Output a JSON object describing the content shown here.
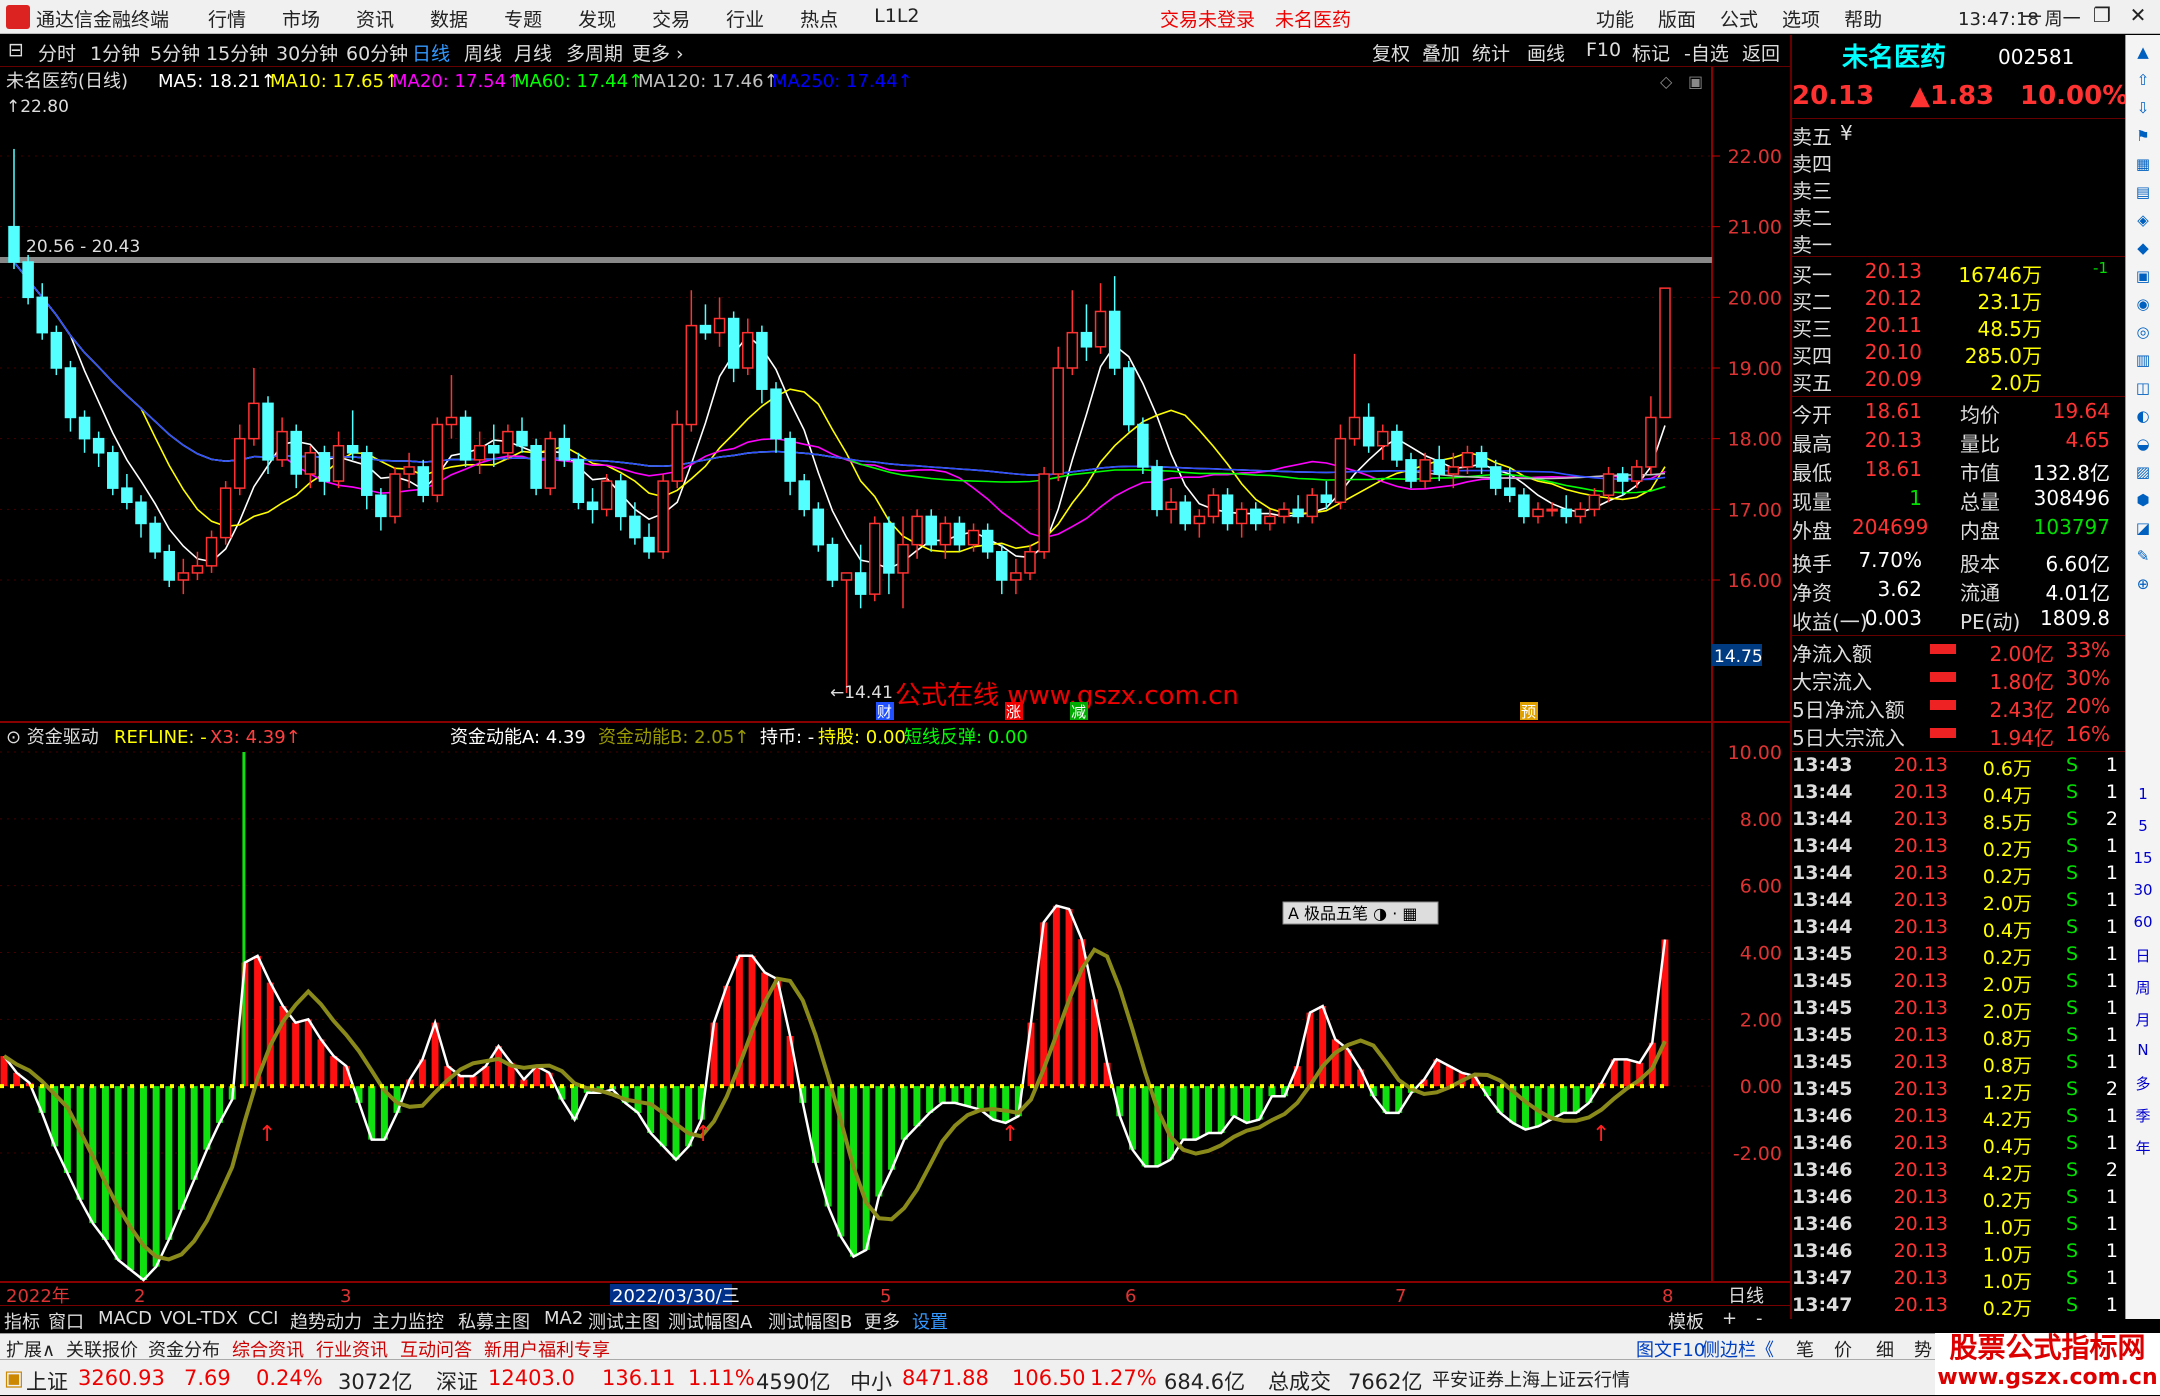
{
  "window": {
    "app_title": "通达信金融终端",
    "main_menu": [
      "行情",
      "市场",
      "资讯",
      "数据",
      "专题",
      "发现",
      "交易",
      "行业",
      "热点",
      "L1L2"
    ],
    "alerts": [
      "交易未登录",
      "未名医药"
    ],
    "right_menu": [
      "功能",
      "版面",
      "公式",
      "选项",
      "帮助"
    ],
    "clock": "13:47:18",
    "weekday": "周一"
  },
  "period_bar": {
    "tabs": [
      "分时",
      "1分钟",
      "5分钟",
      "15分钟",
      "30分钟",
      "60分钟",
      "日线",
      "周线",
      "月线",
      "多周期",
      "更多"
    ],
    "active": "日线",
    "tools": [
      "复权",
      "叠加",
      "统计",
      "画线",
      "F10",
      "标记",
      "-自选",
      "返回"
    ]
  },
  "main_chart": {
    "stock_name": "未名医药(日线)",
    "ma_labels": [
      {
        "text": "MA5: 18.21",
        "color": "#ffffff"
      },
      {
        "text": "MA10: 17.65",
        "color": "#ffff00"
      },
      {
        "text": "MA20: 17.54",
        "color": "#ff00ff"
      },
      {
        "text": "MA60: 17.44",
        "color": "#00ff00"
      },
      {
        "text": "MA120: 17.46",
        "color": "#c0c0c0"
      },
      {
        "text": "MA250: 17.44",
        "color": "#0000ff"
      }
    ],
    "high_label": "22.80",
    "range_label": "20.56 - 20.43",
    "low_label": "14.41",
    "y_ticks": [
      "22.00",
      "21.00",
      "20.00",
      "19.00",
      "18.00",
      "17.00",
      "16.00"
    ],
    "y_values": [
      22,
      21,
      20,
      19,
      18,
      17,
      16
    ],
    "price_box": "14.75",
    "watermark": "公式在线   www.gszx.com.cn",
    "markers": [
      "财",
      "涨",
      "减",
      "预"
    ]
  },
  "indicator": {
    "name": "资金驱动",
    "labels": [
      {
        "text": "REFLINE: -",
        "color": "#ffff00"
      },
      {
        "text": "X3: 4.39",
        "color": "#ff4040"
      },
      {
        "text": "资金动能A: 4.39",
        "color": "#ffffff"
      },
      {
        "text": "资金动能B: 2.05",
        "color": "#999900"
      },
      {
        "text": "持币: -",
        "color": "#ffffff"
      },
      {
        "text": "持股: 0.00",
        "color": "#ffff00"
      },
      {
        "text": "短线反弹: 0.00",
        "color": "#00ff00"
      }
    ],
    "y_ticks": [
      "10.00",
      "8.00",
      "6.00",
      "4.00",
      "2.00",
      "0.00",
      "-2.00"
    ],
    "y_values": [
      10,
      8,
      6,
      4,
      2,
      0,
      -2
    ],
    "pen_toolbar": "极品五笔"
  },
  "x_axis": {
    "labels": [
      "2022年",
      "2",
      "3",
      "2022/03/30/三",
      "5",
      "6",
      "7",
      "8"
    ],
    "period": "日线"
  },
  "quote": {
    "name": "未名医药",
    "code": "002581",
    "price": "20.13",
    "change": "▲1.83",
    "change_pct": "10.00%",
    "sell_rows": [
      "卖五",
      "卖四",
      "卖三",
      "卖二",
      "卖一"
    ],
    "currency_mark": "¥",
    "buy_rows": [
      {
        "label": "买一",
        "price": "20.13",
        "vol": "16746万",
        "delta": "-1"
      },
      {
        "label": "买二",
        "price": "20.12",
        "vol": "23.1万",
        "delta": ""
      },
      {
        "label": "买三",
        "price": "20.11",
        "vol": "48.5万",
        "delta": ""
      },
      {
        "label": "买四",
        "price": "20.10",
        "vol": "285.0万",
        "delta": ""
      },
      {
        "label": "买五",
        "price": "20.09",
        "vol": "2.0万",
        "delta": ""
      }
    ],
    "stats": [
      {
        "l1": "今开",
        "v1": "18.61",
        "c1": "red",
        "l2": "均价",
        "v2": "19.64",
        "c2": "red"
      },
      {
        "l1": "最高",
        "v1": "20.13",
        "c1": "red",
        "l2": "量比",
        "v2": "4.65",
        "c2": "red"
      },
      {
        "l1": "最低",
        "v1": "18.61",
        "c1": "red",
        "l2": "市值",
        "v2": "132.8亿",
        "c2": "white"
      },
      {
        "l1": "现量",
        "v1": "1",
        "c1": "green",
        "l2": "总量",
        "v2": "308496",
        "c2": "white"
      },
      {
        "l1": "外盘",
        "v1": "204699",
        "c1": "red",
        "l2": "内盘",
        "v2": "103797",
        "c2": "green"
      },
      {
        "l1": "换手",
        "v1": "7.70%",
        "c1": "white",
        "l2": "股本",
        "v2": "6.60亿",
        "c2": "white"
      },
      {
        "l1": "净资",
        "v1": "3.62",
        "c1": "white",
        "l2": "流通",
        "v2": "4.01亿",
        "c2": "white"
      },
      {
        "l1": "收益(一)",
        "v1": "0.003",
        "c1": "white",
        "l2": "PE(动)",
        "v2": "1809.8",
        "c2": "white"
      }
    ],
    "flows": [
      {
        "label": "净流入额",
        "val": "2.00亿",
        "pct": "33%"
      },
      {
        "label": "大宗流入",
        "val": "1.80亿",
        "pct": "30%"
      },
      {
        "label": "5日净流入额",
        "val": "2.43亿",
        "pct": "20%"
      },
      {
        "label": "5日大宗流入",
        "val": "1.94亿",
        "pct": "16%"
      }
    ],
    "ticks": [
      [
        "13:43",
        "20.13",
        "0.6万",
        "S",
        "1"
      ],
      [
        "13:44",
        "20.13",
        "0.4万",
        "S",
        "1"
      ],
      [
        "13:44",
        "20.13",
        "8.5万",
        "S",
        "2"
      ],
      [
        "13:44",
        "20.13",
        "0.2万",
        "S",
        "1"
      ],
      [
        "13:44",
        "20.13",
        "0.2万",
        "S",
        "1"
      ],
      [
        "13:44",
        "20.13",
        "2.0万",
        "S",
        "1"
      ],
      [
        "13:44",
        "20.13",
        "0.4万",
        "S",
        "1"
      ],
      [
        "13:45",
        "20.13",
        "0.2万",
        "S",
        "1"
      ],
      [
        "13:45",
        "20.13",
        "2.0万",
        "S",
        "1"
      ],
      [
        "13:45",
        "20.13",
        "2.0万",
        "S",
        "1"
      ],
      [
        "13:45",
        "20.13",
        "0.8万",
        "S",
        "1"
      ],
      [
        "13:45",
        "20.13",
        "0.8万",
        "S",
        "1"
      ],
      [
        "13:45",
        "20.13",
        "1.2万",
        "S",
        "2"
      ],
      [
        "13:46",
        "20.13",
        "4.2万",
        "S",
        "1"
      ],
      [
        "13:46",
        "20.13",
        "0.4万",
        "S",
        "1"
      ],
      [
        "13:46",
        "20.13",
        "4.2万",
        "S",
        "2"
      ],
      [
        "13:46",
        "20.13",
        "0.2万",
        "S",
        "1"
      ],
      [
        "13:46",
        "20.13",
        "1.0万",
        "S",
        "1"
      ],
      [
        "13:46",
        "20.13",
        "1.0万",
        "S",
        "1"
      ],
      [
        "13:47",
        "20.13",
        "1.0万",
        "S",
        "1"
      ],
      [
        "13:47",
        "20.13",
        "0.2万",
        "S",
        "1"
      ]
    ]
  },
  "sidebar_labels": [
    "1",
    "5",
    "15",
    "30",
    "60",
    "日",
    "周",
    "月",
    "N",
    "多",
    "季",
    "年"
  ],
  "indicator_tabs": [
    "指标",
    "窗口",
    "MACD",
    "VOL-TDX",
    "CCI",
    "趋势动力",
    "主力监控",
    "私募主图",
    "MA2",
    "测试主图",
    "测试幅图A",
    "测试幅图B",
    "更多",
    "设置",
    "模板",
    "+",
    "-"
  ],
  "func_tabs": [
    "扩展∧",
    "关联报价",
    "资金分布",
    "综合资讯",
    "行业资讯",
    "互动问答",
    "新用户福利专享",
    "图文F10",
    "侧边栏《",
    "笔",
    "价",
    "细",
    "势"
  ],
  "status": {
    "sh_label": "上证",
    "sh": "3260.93",
    "sh_ch": "7.69",
    "sh_pct": "0.24%",
    "sh_amt": "3072亿",
    "sz_label": "深证",
    "sz": "12403.0",
    "sz_ch": "136.11",
    "sz_pct": "1.11%",
    "sz_amt": "4590亿",
    "zx_label": "中小",
    "zx": "8471.88",
    "zx_ch": "106.50",
    "zx_pct": "1.27%",
    "zx_amt": "684.6亿",
    "total_label": "总成交",
    "total": "7662亿",
    "broker": "平安证券上海上证云行情"
  },
  "brand_watermark": [
    "股票公式指标网",
    "www.gszx.com.cn"
  ],
  "chart_data": {
    "type": "candlestick",
    "ma_periods": [
      5,
      10,
      20,
      60,
      120,
      250
    ],
    "ohlc": [
      [
        21.0,
        22.1,
        20.4,
        20.5
      ],
      [
        20.5,
        20.6,
        19.9,
        20.0
      ],
      [
        20.0,
        20.2,
        19.4,
        19.5
      ],
      [
        19.5,
        19.6,
        18.9,
        19.0
      ],
      [
        19.0,
        19.1,
        18.1,
        18.3
      ],
      [
        18.3,
        18.4,
        17.8,
        18.0
      ],
      [
        18.0,
        18.1,
        17.6,
        17.8
      ],
      [
        17.8,
        17.9,
        17.2,
        17.3
      ],
      [
        17.3,
        17.5,
        17.0,
        17.1
      ],
      [
        17.1,
        17.2,
        16.6,
        16.8
      ],
      [
        16.8,
        16.9,
        16.3,
        16.4
      ],
      [
        16.4,
        16.5,
        15.9,
        16.0
      ],
      [
        16.0,
        16.3,
        15.8,
        16.1
      ],
      [
        16.1,
        16.4,
        16.0,
        16.2
      ],
      [
        16.2,
        16.7,
        16.1,
        16.6
      ],
      [
        16.6,
        17.4,
        16.5,
        17.3
      ],
      [
        17.3,
        18.2,
        17.2,
        18.0
      ],
      [
        18.0,
        19.0,
        17.9,
        18.5
      ],
      [
        18.5,
        18.6,
        17.5,
        17.7
      ],
      [
        17.7,
        18.3,
        17.6,
        18.1
      ],
      [
        18.1,
        18.2,
        17.3,
        17.5
      ],
      [
        17.5,
        17.9,
        17.3,
        17.8
      ],
      [
        17.8,
        17.9,
        17.2,
        17.4
      ],
      [
        17.4,
        18.1,
        17.3,
        17.9
      ],
      [
        17.9,
        18.4,
        17.7,
        17.8
      ],
      [
        17.8,
        17.9,
        17.0,
        17.2
      ],
      [
        17.2,
        17.3,
        16.7,
        16.9
      ],
      [
        16.9,
        17.6,
        16.8,
        17.5
      ],
      [
        17.5,
        17.8,
        17.3,
        17.6
      ],
      [
        17.6,
        17.7,
        17.1,
        17.2
      ],
      [
        17.2,
        18.3,
        17.1,
        18.2
      ],
      [
        18.2,
        18.9,
        18.0,
        18.3
      ],
      [
        18.3,
        18.4,
        17.6,
        17.7
      ],
      [
        17.7,
        18.1,
        17.5,
        17.9
      ],
      [
        17.9,
        18.2,
        17.6,
        17.8
      ],
      [
        17.8,
        18.2,
        17.7,
        18.1
      ],
      [
        18.1,
        18.3,
        17.8,
        17.9
      ],
      [
        17.9,
        18.0,
        17.2,
        17.3
      ],
      [
        17.3,
        18.1,
        17.2,
        18.0
      ],
      [
        18.0,
        18.2,
        17.6,
        17.7
      ],
      [
        17.7,
        17.8,
        17.0,
        17.1
      ],
      [
        17.1,
        17.3,
        16.8,
        17.0
      ],
      [
        17.0,
        17.5,
        16.9,
        17.4
      ],
      [
        17.4,
        17.5,
        16.7,
        16.9
      ],
      [
        16.9,
        17.1,
        16.5,
        16.6
      ],
      [
        16.6,
        16.8,
        16.3,
        16.4
      ],
      [
        16.4,
        17.5,
        16.3,
        17.4
      ],
      [
        17.4,
        18.4,
        17.3,
        18.2
      ],
      [
        18.2,
        20.1,
        18.1,
        19.6
      ],
      [
        19.6,
        19.9,
        19.4,
        19.5
      ],
      [
        19.5,
        20.0,
        19.3,
        19.7
      ],
      [
        19.7,
        19.8,
        18.8,
        19.0
      ],
      [
        19.0,
        19.7,
        18.9,
        19.5
      ],
      [
        19.5,
        19.6,
        18.5,
        18.7
      ],
      [
        18.7,
        18.8,
        17.8,
        18.0
      ],
      [
        18.0,
        18.1,
        17.2,
        17.4
      ],
      [
        17.4,
        17.5,
        16.9,
        17.0
      ],
      [
        17.0,
        17.1,
        16.4,
        16.5
      ],
      [
        16.5,
        16.6,
        15.9,
        16.0
      ],
      [
        16.0,
        16.1,
        14.4,
        16.1
      ],
      [
        16.1,
        16.5,
        15.6,
        15.8
      ],
      [
        15.8,
        16.9,
        15.7,
        16.8
      ],
      [
        16.8,
        16.9,
        15.8,
        16.1
      ],
      [
        16.1,
        16.9,
        15.6,
        16.5
      ],
      [
        16.5,
        17.0,
        16.3,
        16.9
      ],
      [
        16.9,
        17.0,
        16.4,
        16.5
      ],
      [
        16.5,
        16.9,
        16.3,
        16.8
      ],
      [
        16.8,
        16.9,
        16.4,
        16.5
      ],
      [
        16.5,
        16.8,
        16.4,
        16.7
      ],
      [
        16.7,
        16.8,
        16.3,
        16.4
      ],
      [
        16.4,
        16.5,
        15.8,
        16.0
      ],
      [
        16.0,
        16.3,
        15.8,
        16.1
      ],
      [
        16.1,
        16.5,
        16.0,
        16.4
      ],
      [
        16.4,
        17.6,
        16.3,
        17.5
      ],
      [
        17.5,
        19.3,
        17.4,
        19.0
      ],
      [
        19.0,
        20.1,
        18.9,
        19.5
      ],
      [
        19.5,
        19.9,
        19.1,
        19.3
      ],
      [
        19.3,
        20.2,
        19.2,
        19.8
      ],
      [
        19.8,
        20.3,
        18.9,
        19.0
      ],
      [
        19.0,
        19.1,
        18.1,
        18.2
      ],
      [
        18.2,
        18.3,
        17.5,
        17.6
      ],
      [
        17.6,
        17.7,
        16.9,
        17.0
      ],
      [
        17.0,
        17.3,
        16.8,
        17.1
      ],
      [
        17.1,
        17.2,
        16.7,
        16.8
      ],
      [
        16.8,
        17.0,
        16.6,
        16.9
      ],
      [
        16.9,
        17.3,
        16.8,
        17.2
      ],
      [
        17.2,
        17.3,
        16.7,
        16.8
      ],
      [
        16.8,
        17.1,
        16.6,
        17.0
      ],
      [
        17.0,
        17.1,
        16.7,
        16.8
      ],
      [
        16.8,
        17.0,
        16.7,
        16.9
      ],
      [
        16.9,
        17.1,
        16.8,
        17.0
      ],
      [
        17.0,
        17.2,
        16.8,
        16.9
      ],
      [
        16.9,
        17.3,
        16.8,
        17.2
      ],
      [
        17.2,
        17.4,
        17.0,
        17.1
      ],
      [
        17.1,
        18.2,
        17.0,
        18.0
      ],
      [
        18.0,
        19.2,
        17.9,
        18.3
      ],
      [
        18.3,
        18.5,
        17.8,
        17.9
      ],
      [
        17.9,
        18.2,
        17.7,
        18.1
      ],
      [
        18.1,
        18.2,
        17.6,
        17.7
      ],
      [
        17.7,
        17.8,
        17.3,
        17.4
      ],
      [
        17.4,
        17.8,
        17.3,
        17.7
      ],
      [
        17.7,
        17.9,
        17.4,
        17.5
      ],
      [
        17.5,
        17.8,
        17.3,
        17.6
      ],
      [
        17.6,
        17.9,
        17.5,
        17.8
      ],
      [
        17.8,
        17.9,
        17.5,
        17.6
      ],
      [
        17.6,
        17.7,
        17.2,
        17.3
      ],
      [
        17.3,
        17.6,
        17.1,
        17.2
      ],
      [
        17.2,
        17.3,
        16.8,
        16.9
      ],
      [
        16.9,
        17.1,
        16.8,
        17.0
      ],
      [
        17.0,
        17.1,
        16.9,
        17.0
      ],
      [
        17.0,
        17.2,
        16.8,
        16.9
      ],
      [
        16.9,
        17.1,
        16.8,
        17.0
      ],
      [
        17.0,
        17.3,
        16.9,
        17.2
      ],
      [
        17.2,
        17.6,
        17.1,
        17.5
      ],
      [
        17.5,
        17.6,
        17.2,
        17.4
      ],
      [
        17.4,
        17.7,
        17.3,
        17.6
      ],
      [
        17.6,
        18.6,
        17.5,
        18.3
      ],
      [
        18.3,
        20.13,
        18.3,
        20.13
      ]
    ],
    "indicator_values": [
      0.9,
      0.4,
      0.1,
      -0.8,
      -1.8,
      -2.6,
      -3.4,
      -4.1,
      -4.6,
      -5.2,
      -5.5,
      -5.8,
      -5.4,
      -4.6,
      -3.7,
      -2.8,
      -1.9,
      -1.1,
      -0.4,
      3.7,
      3.9,
      3.1,
      2.4,
      1.9,
      2.0,
      1.4,
      0.9,
      0.6,
      -0.5,
      -1.6,
      -1.6,
      -0.8,
      0.2,
      0.8,
      1.9,
      0.6,
      0.3,
      0.3,
      0.6,
      1.2,
      0.7,
      0.2,
      0.6,
      0.4,
      -0.4,
      -1.0,
      -0.2,
      -0.2,
      -0.1,
      -0.5,
      -0.8,
      -1.4,
      -1.8,
      -2.2,
      -1.8,
      -1.0,
      1.9,
      3.0,
      3.9,
      3.9,
      3.4,
      3.2,
      1.5,
      -0.5,
      -2.3,
      -3.6,
      -4.5,
      -5.1,
      -4.9,
      -3.3,
      -2.5,
      -1.6,
      -1.2,
      -0.8,
      -0.5,
      -0.5,
      -0.6,
      -0.7,
      -1.0,
      -1.1,
      -0.9,
      1.9,
      4.9,
      5.4,
      5.3,
      4.4,
      2.6,
      0.7,
      -0.9,
      -1.9,
      -2.4,
      -2.4,
      -2.2,
      -1.6,
      -1.6,
      -1.4,
      -1.4,
      -0.9,
      -1.1,
      -1.0,
      -0.3,
      -0.3,
      0.6,
      2.2,
      2.4,
      1.4,
      1.1,
      0.5,
      -0.3,
      -0.8,
      -0.8,
      -0.2,
      0.2,
      0.8,
      0.6,
      0.4,
      0.3,
      -0.3,
      -0.8,
      -1.1,
      -1.3,
      -1.2,
      -1.0,
      -0.8,
      -0.8,
      -0.5,
      0.1,
      0.8,
      0.8,
      0.7,
      1.3,
      4.39
    ],
    "ylim_main": [
      14.0,
      23.0
    ],
    "ylim_indicator": [
      -3.2,
      10.5
    ]
  }
}
